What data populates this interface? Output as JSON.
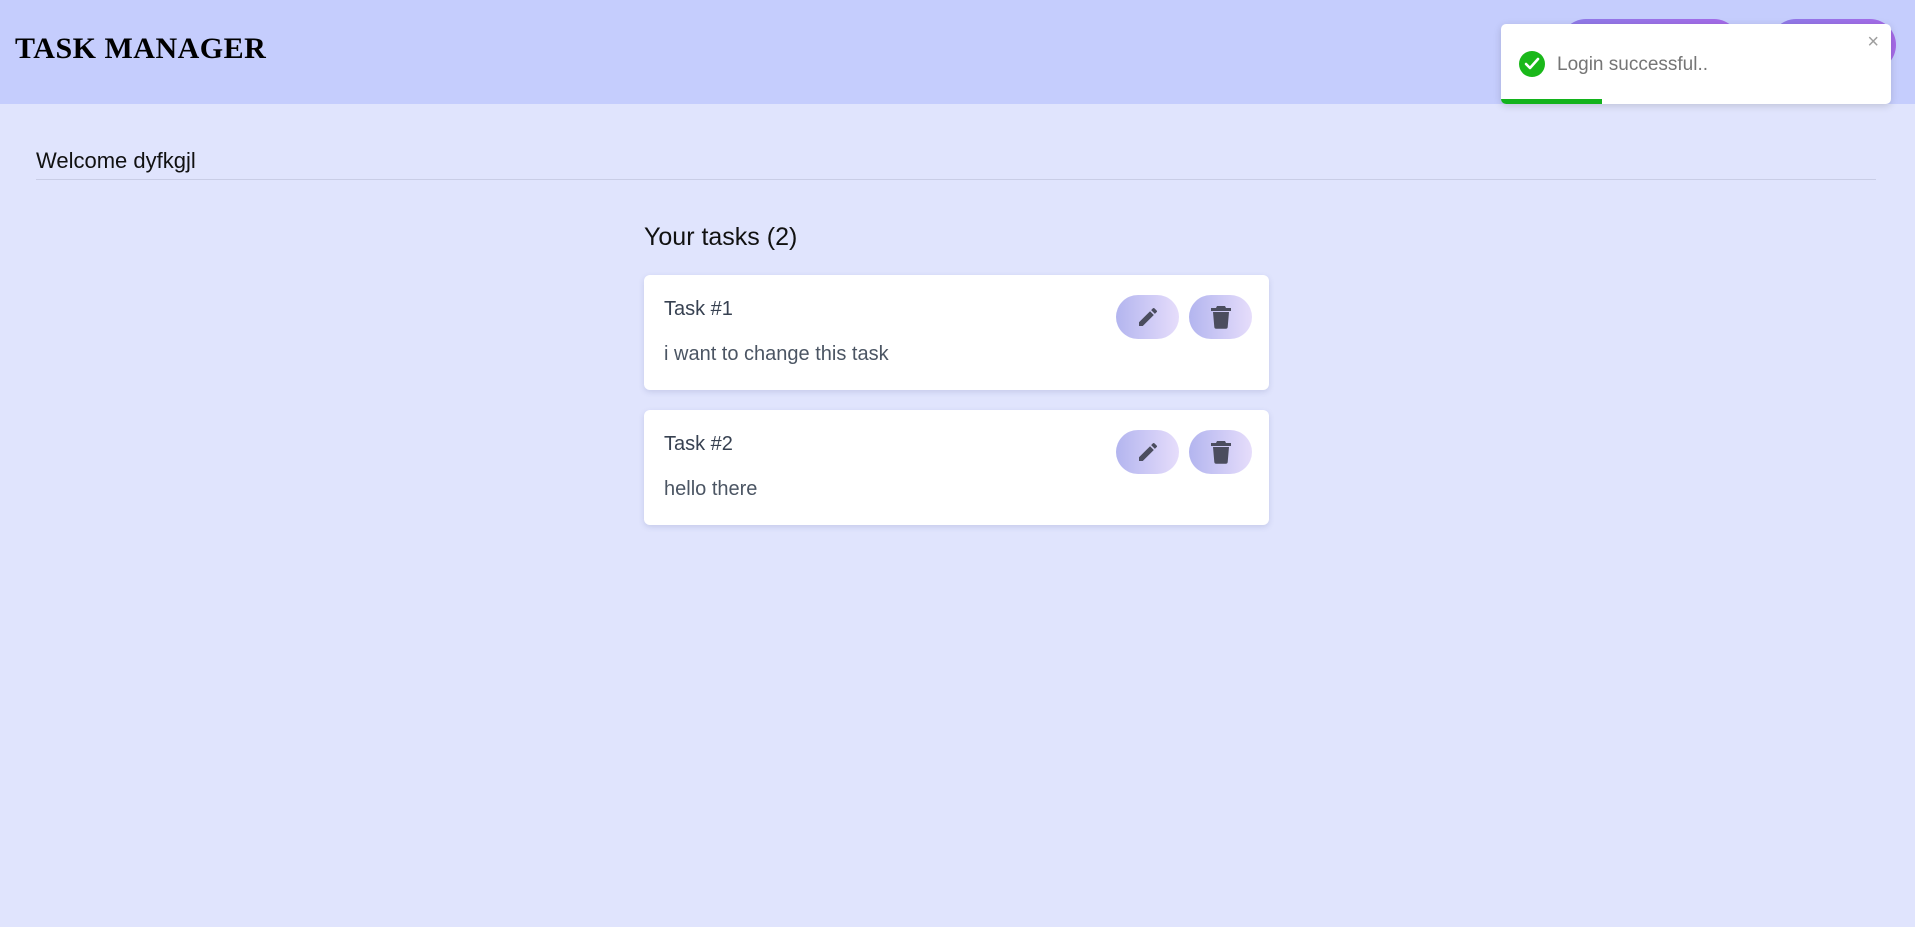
{
  "header": {
    "brand": "TASK MANAGER"
  },
  "toast": {
    "message": "Login successful..",
    "close_glyph": "×",
    "icon": "check-circle-icon",
    "progress_fraction": 0.26,
    "color": "#13b31c"
  },
  "welcome": "Welcome dyfkgjl",
  "tasks_heading": "Your tasks (2)",
  "tasks": [
    {
      "title": "Task #1",
      "description": "i want to change this task"
    },
    {
      "title": "Task #2",
      "description": "hello there"
    }
  ],
  "icons": {
    "edit": "pencil-icon",
    "delete": "trash-icon"
  }
}
